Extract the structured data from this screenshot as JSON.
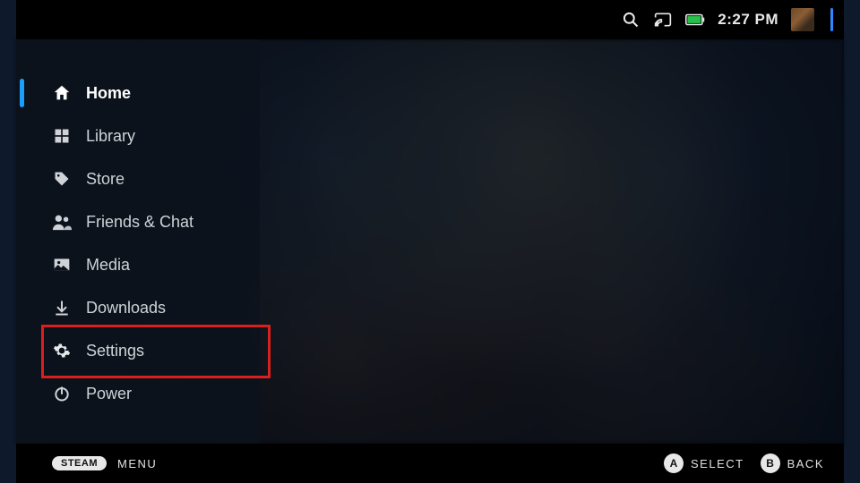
{
  "status": {
    "time": "2:27 PM"
  },
  "sidebar": {
    "items": [
      {
        "id": "home",
        "label": "Home",
        "icon": "home-icon",
        "active": true
      },
      {
        "id": "library",
        "label": "Library",
        "icon": "grid-icon",
        "active": false
      },
      {
        "id": "store",
        "label": "Store",
        "icon": "tag-icon",
        "active": false
      },
      {
        "id": "friends",
        "label": "Friends & Chat",
        "icon": "people-icon",
        "active": false
      },
      {
        "id": "media",
        "label": "Media",
        "icon": "image-icon",
        "active": false
      },
      {
        "id": "downloads",
        "label": "Downloads",
        "icon": "download-icon",
        "active": false
      },
      {
        "id": "settings",
        "label": "Settings",
        "icon": "gear-icon",
        "active": false
      },
      {
        "id": "power",
        "label": "Power",
        "icon": "power-icon",
        "active": false
      }
    ],
    "highlighted": "settings"
  },
  "hints": {
    "left_pill": "STEAM",
    "left_label": "MENU",
    "right": [
      {
        "key": "A",
        "label": "SELECT"
      },
      {
        "key": "B",
        "label": "BACK"
      }
    ]
  }
}
